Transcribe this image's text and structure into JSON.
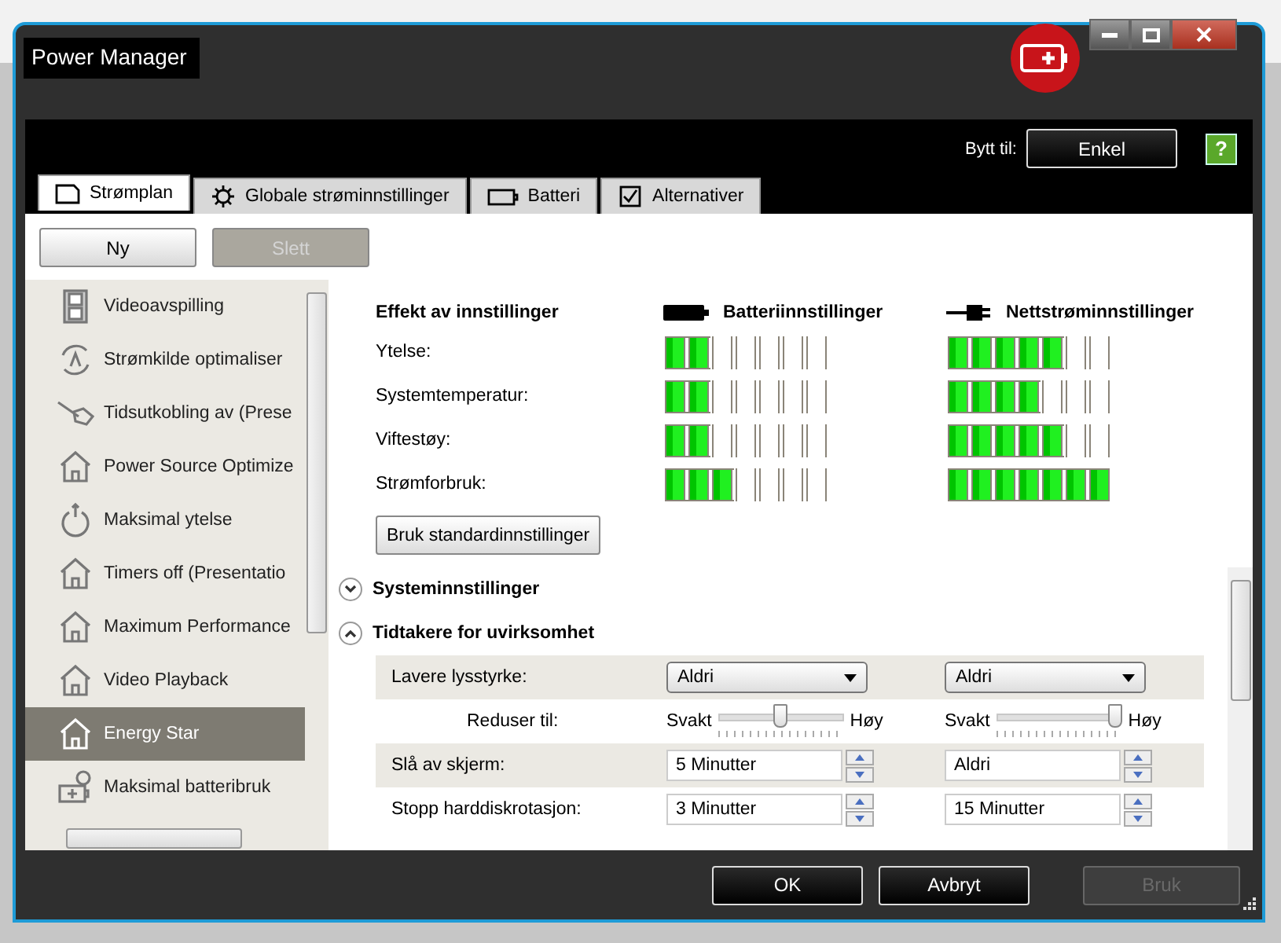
{
  "window": {
    "title": "Power Manager"
  },
  "switch": {
    "label": "Bytt til:",
    "button": "Enkel",
    "help": "?"
  },
  "tabs": [
    {
      "label": "Strømplan",
      "kind": "plan",
      "selected": true
    },
    {
      "label": "Globale strøminnstillinger",
      "kind": "gear",
      "selected": false
    },
    {
      "label": "Batteri",
      "kind": "battery",
      "selected": false
    },
    {
      "label": "Alternativer",
      "kind": "check",
      "selected": false
    }
  ],
  "plan_buttons": [
    {
      "label": "Ny",
      "disabled": false
    },
    {
      "label": "Slett",
      "disabled": true
    }
  ],
  "plans": [
    {
      "label": "Videoavspilling",
      "kind": "film",
      "selected": false
    },
    {
      "label": "Strømkilde optimaliser",
      "kind": "cycle",
      "selected": false
    },
    {
      "label": "Tidsutkobling av (Prese",
      "kind": "tag",
      "selected": false
    },
    {
      "label": "Power Source Optimize",
      "kind": "house",
      "selected": false
    },
    {
      "label": "Maksimal ytelse",
      "kind": "power",
      "selected": false
    },
    {
      "label": "Timers off (Presentatio",
      "kind": "house",
      "selected": false
    },
    {
      "label": "Maximum Performance",
      "kind": "house",
      "selected": false
    },
    {
      "label": "Video Playback",
      "kind": "house",
      "selected": false
    },
    {
      "label": "Energy Star",
      "kind": "house",
      "selected": true
    },
    {
      "label": "Maksimal batteribruk",
      "kind": "battery-clock",
      "selected": false
    }
  ],
  "effects": {
    "title": "Effekt av innstillinger",
    "battery_heading": "Batteriinnstillinger",
    "ac_heading": "Nettstrøminnstillinger",
    "rows": [
      {
        "label": "Ytelse:",
        "battery": {
          "level": 0.2857
        },
        "ac": {
          "level": 0.7143
        }
      },
      {
        "label": "Systemtemperatur:",
        "battery": {
          "level": 0.2857
        },
        "ac": {
          "level": 0.5714
        }
      },
      {
        "label": "Viftestøy:",
        "battery": {
          "level": 0.2857
        },
        "ac": {
          "level": 0.7143
        }
      },
      {
        "label": "Strømforbruk:",
        "battery": {
          "level": 0.4286
        },
        "ac": {
          "level": 1
        }
      }
    ],
    "reset_button": "Bruk standardinnstillinger"
  },
  "sections": [
    {
      "title": "Systeminnstillinger",
      "expanded": false
    },
    {
      "title": "Tidtakere for uvirksomhet",
      "expanded": true
    }
  ],
  "timers": [
    {
      "kind": "dropdown",
      "label": "Lavere lysstyrke:",
      "battery": {
        "value": "Aldri"
      },
      "ac": {
        "value": "Aldri"
      }
    },
    {
      "kind": "slider",
      "label": "Reduser til:",
      "battery": {
        "low": "Svakt",
        "high": "Høy",
        "level": 0.5
      },
      "ac": {
        "low": "Svakt",
        "high": "Høy",
        "level": 1
      }
    },
    {
      "kind": "spinner",
      "label": "Slå av skjerm:",
      "battery": {
        "value": "5 Minutter"
      },
      "ac": {
        "value": "Aldri"
      }
    },
    {
      "kind": "spinner",
      "label": "Stopp harddiskrotasjon:",
      "battery": {
        "value": "3 Minutter"
      },
      "ac": {
        "value": "15 Minutter"
      }
    }
  ],
  "footer_buttons": [
    {
      "label": "OK",
      "disabled": false
    },
    {
      "label": "Avbryt",
      "disabled": false
    },
    {
      "label": "Bruk",
      "disabled": true
    }
  ]
}
